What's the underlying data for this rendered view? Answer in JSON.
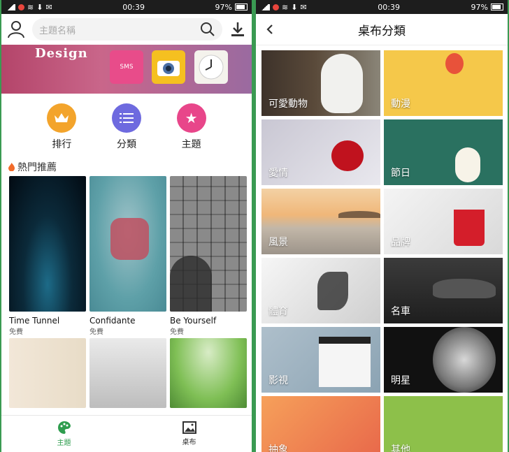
{
  "left": {
    "status": {
      "time": "00:39",
      "battery": "97%"
    },
    "search_placeholder": "主題名稱",
    "banner_text": "Design",
    "banner_icons": {
      "sms": "SMS"
    },
    "categories": [
      {
        "label": "排行",
        "icon": "crown-icon",
        "color": "#f3a42c"
      },
      {
        "label": "分類",
        "icon": "list-icon",
        "color": "#6e6adf"
      },
      {
        "label": "主題",
        "icon": "star-icon",
        "color": "#e8468a"
      }
    ],
    "hot_title": "熱門推薦",
    "themes": [
      {
        "name": "Time Tunnel",
        "price": "免費"
      },
      {
        "name": "Confidante",
        "price": "免費"
      },
      {
        "name": "Be Yourself",
        "price": "免費"
      }
    ],
    "bottom_nav": [
      {
        "label": "主題",
        "icon": "palette-icon",
        "active": true
      },
      {
        "label": "桌布",
        "icon": "image-icon",
        "active": false
      }
    ]
  },
  "right": {
    "status": {
      "time": "00:39",
      "battery": "97%"
    },
    "title": "桌布分類",
    "categories": [
      {
        "label": "可愛動物"
      },
      {
        "label": "動漫"
      },
      {
        "label": "愛情"
      },
      {
        "label": "節日"
      },
      {
        "label": "風景"
      },
      {
        "label": "品牌"
      },
      {
        "label": "體育"
      },
      {
        "label": "名車"
      },
      {
        "label": "影視"
      },
      {
        "label": "明星"
      },
      {
        "label": "抽象"
      },
      {
        "label": "其他"
      }
    ]
  }
}
